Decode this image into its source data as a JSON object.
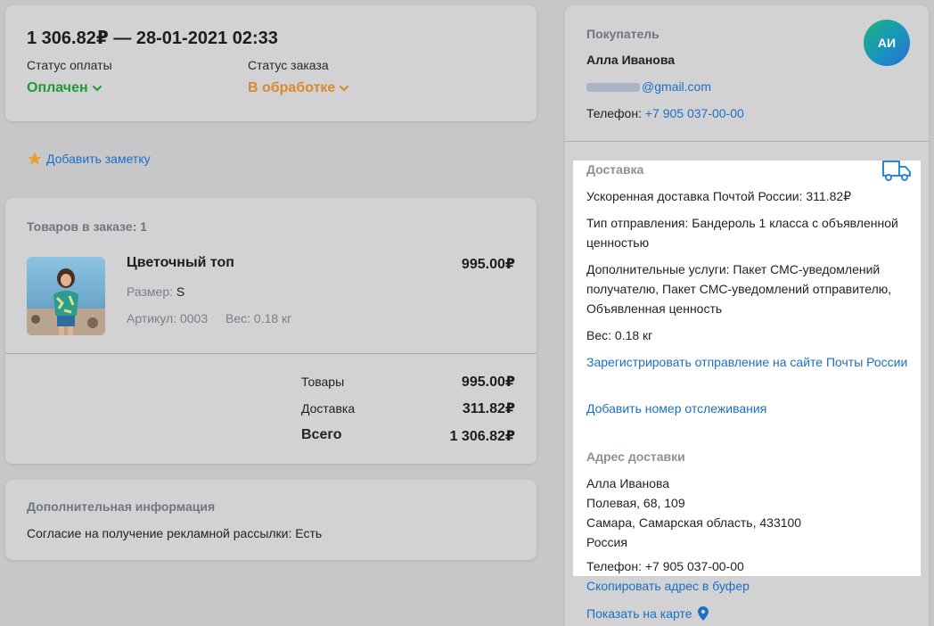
{
  "order": {
    "title": "1 306.82₽ — 28-01-2021 02:33",
    "payment_status_label": "Статус оплаты",
    "payment_status_value": "Оплачен",
    "order_status_label": "Статус заказа",
    "order_status_value": "В обработке"
  },
  "note": {
    "label": "Добавить заметку"
  },
  "items": {
    "header": "Товаров в заказе: 1",
    "product": {
      "name": "Цветочный топ",
      "price": "995.00₽",
      "size_label": "Размер:",
      "size_value": "S",
      "sku": "Артикул: 0003",
      "weight": "Вес: 0.18 кг"
    },
    "totals": {
      "goods_label": "Товары",
      "goods_value": "995.00₽",
      "delivery_label": "Доставка",
      "delivery_value": "311.82₽",
      "total_label": "Всего",
      "total_value": "1 306.82₽"
    }
  },
  "extra": {
    "header": "Дополнительная информация",
    "text": "Согласие на получение рекламной рассылки: Есть"
  },
  "buyer": {
    "header": "Покупатель",
    "name": "Алла Иванова",
    "initials": "АИ",
    "email_domain": "@gmail.com",
    "phone_label": "Телефон:",
    "phone_value": "+7 905 037-00-00"
  },
  "delivery": {
    "header": "Доставка",
    "method": "Ускоренная доставка Почтой России: 311.82₽",
    "type": "Тип отправления: Бандероль 1 класса с объявленной ценностью",
    "services": "Дополнительные услуги: Пакет СМС-уведомлений получателю, Пакет СМС-уведомлений отправителю, Объявленная ценность",
    "weight": "Вес: 0.18 кг",
    "register_link": "Зарегистрировать отправление на сайте Почты России",
    "tracking_link": "Добавить номер отслеживания"
  },
  "address": {
    "header": "Адрес доставки",
    "name": "Алла Иванова",
    "street": "Полевая, 68, 109",
    "city": "Самара, Самарская область, 433100",
    "country": "Россия",
    "phone": "Телефон: +7 905 037-00-00",
    "copy_link": "Скопировать адрес в буфер",
    "map_link": "Показать на карте"
  },
  "colors": {
    "paid": "#1f9a34",
    "processing": "#d98a2a",
    "link": "#1b6fc4"
  }
}
